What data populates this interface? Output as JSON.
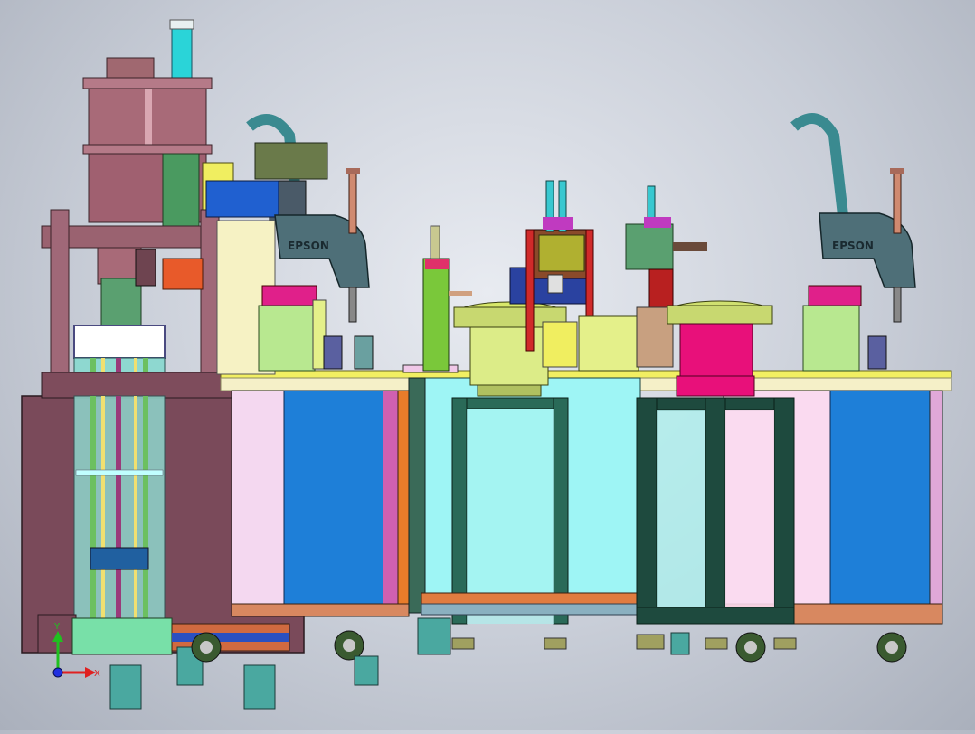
{
  "viewport": {
    "background": "#c9ced8"
  },
  "robots": [
    {
      "brand": "EPSON",
      "color": "#4e6f78"
    },
    {
      "brand": "EPSON",
      "color": "#4e6f78"
    }
  ],
  "axis_triad": {
    "x_label": "X",
    "y_label": "Y",
    "x_color": "#e02020",
    "y_color": "#20c020",
    "z_color": "#2030e0"
  },
  "colors": {
    "frame_maroon": "#7a4a5a",
    "table_yellow": "#f2ef62",
    "panel_blue": "#1e7fd8",
    "panel_cyan": "#9ef5f5",
    "bowl_yellow": "#e4f08a",
    "bowl_magenta": "#e8107a",
    "extrusion_green": "#1e5a48"
  }
}
